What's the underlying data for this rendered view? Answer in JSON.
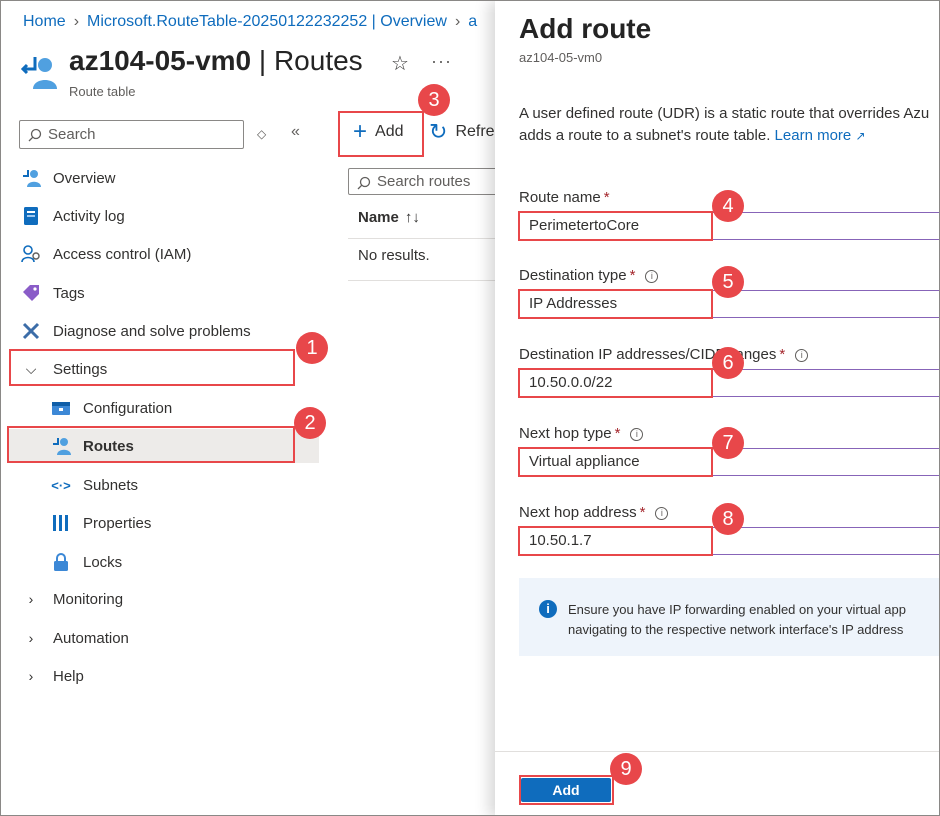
{
  "breadcrumb": {
    "home": "Home",
    "resource": "Microsoft.RouteTable-20250122232252 | Overview",
    "overflow": "a"
  },
  "header": {
    "title_bold": "az104-05-vm0",
    "title_rest": " | Routes",
    "subtitle": "Route table",
    "star_icon": "☆",
    "more_icon": "···"
  },
  "sidebar": {
    "search_placeholder": "Search",
    "items": [
      {
        "label": "Overview",
        "icon": "route-table-icon"
      },
      {
        "label": "Activity log",
        "icon": "activity-log-icon"
      },
      {
        "label": "Access control (IAM)",
        "icon": "iam-icon"
      },
      {
        "label": "Tags",
        "icon": "tag-icon"
      },
      {
        "label": "Diagnose and solve problems",
        "icon": "wrench-icon"
      },
      {
        "label": "Settings",
        "icon": "chevron-down-icon"
      },
      {
        "label": "Configuration",
        "icon": "configuration-icon"
      },
      {
        "label": "Routes",
        "icon": "route-icon"
      },
      {
        "label": "Subnets",
        "icon": "subnet-icon"
      },
      {
        "label": "Properties",
        "icon": "properties-icon"
      },
      {
        "label": "Locks",
        "icon": "lock-icon"
      },
      {
        "label": "Monitoring",
        "icon": "chevron-right-icon"
      },
      {
        "label": "Automation",
        "icon": "chevron-right-icon"
      },
      {
        "label": "Help",
        "icon": "chevron-right-icon"
      }
    ]
  },
  "commands": {
    "add": "Add",
    "refresh": "Refres"
  },
  "grid": {
    "search_placeholder": "Search routes",
    "column_name": "Name",
    "sort_icon": "↑↓",
    "empty": "No results."
  },
  "panel": {
    "title": "Add route",
    "subtitle": "az104-05-vm0",
    "desc_line1": "A user defined route (UDR) is a static route that overrides Azu",
    "desc_line2": "adds a route to a subnet's route table. ",
    "learn_more": "Learn more",
    "fields": {
      "route_name": {
        "label": "Route name",
        "value": "PerimetertoCore"
      },
      "destination_type": {
        "label": "Destination type",
        "value": "IP Addresses"
      },
      "destination_ip": {
        "label": "Destination IP addresses/CIDR ranges",
        "value": "10.50.0.0/22"
      },
      "next_hop_type": {
        "label": "Next hop type",
        "value": "Virtual appliance"
      },
      "next_hop_address": {
        "label": "Next hop address",
        "value": "10.50.1.7"
      }
    },
    "required_mark": "*",
    "info_line1": "Ensure you have IP forwarding enabled on your virtual app",
    "info_line2": "navigating to the respective network interface's IP address",
    "add_button": "Add"
  },
  "callouts": [
    "1",
    "2",
    "3",
    "4",
    "5",
    "6",
    "7",
    "8",
    "9"
  ],
  "colors": {
    "accent": "#0f6cbd",
    "callout": "#e8474a",
    "required": "#a4262c"
  }
}
